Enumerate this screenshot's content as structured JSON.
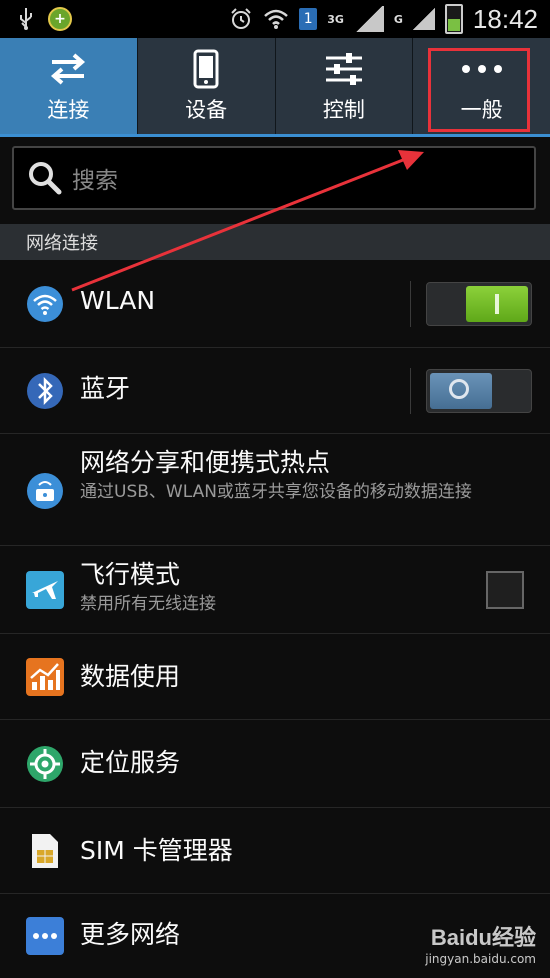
{
  "status_bar": {
    "left_icons": [
      "usb-icon",
      "app-notification-icon"
    ],
    "right_icons": [
      "alarm-icon",
      "wifi-icon",
      "sim-1-icon",
      "signal-3g-icon",
      "signal-g-icon",
      "battery-charging-icon"
    ],
    "sim_label": "1",
    "net_3g": "3G",
    "net_g": "G",
    "time": "18:42"
  },
  "tabs": [
    {
      "label": "连接",
      "icon": "swap-arrows-icon",
      "active": true
    },
    {
      "label": "设备",
      "icon": "phone-device-icon",
      "active": false
    },
    {
      "label": "控制",
      "icon": "sliders-icon",
      "active": false
    },
    {
      "label": "一般",
      "icon": "more-dots-icon",
      "active": false
    }
  ],
  "search": {
    "placeholder": "搜索",
    "icon": "search-icon"
  },
  "section": {
    "title": "网络连接"
  },
  "items": [
    {
      "title": "WLAN",
      "icon": "wifi-icon",
      "control": "switch",
      "state": "on"
    },
    {
      "title": "蓝牙",
      "icon": "bluetooth-icon",
      "control": "switch",
      "state": "off"
    },
    {
      "title": "网络分享和便携式热点",
      "subtitle": "通过USB、WLAN或蓝牙共享您设备的移动数据连接",
      "icon": "hotspot-icon"
    },
    {
      "title": "飞行模式",
      "subtitle": "禁用所有无线连接",
      "icon": "airplane-icon",
      "control": "checkbox",
      "state": "unchecked"
    },
    {
      "title": "数据使用",
      "icon": "data-usage-icon"
    },
    {
      "title": "定位服务",
      "icon": "location-icon"
    },
    {
      "title": "SIM 卡管理器",
      "icon": "sim-card-icon"
    },
    {
      "title": "更多网络",
      "icon": "more-networks-icon"
    }
  ],
  "colors": {
    "accent": "#3a7fb5",
    "switch_on": "#7ac043",
    "annotation": "#e8323a"
  },
  "watermark": {
    "brand": "Baidu经验",
    "url": "jingyan.baidu.com"
  }
}
